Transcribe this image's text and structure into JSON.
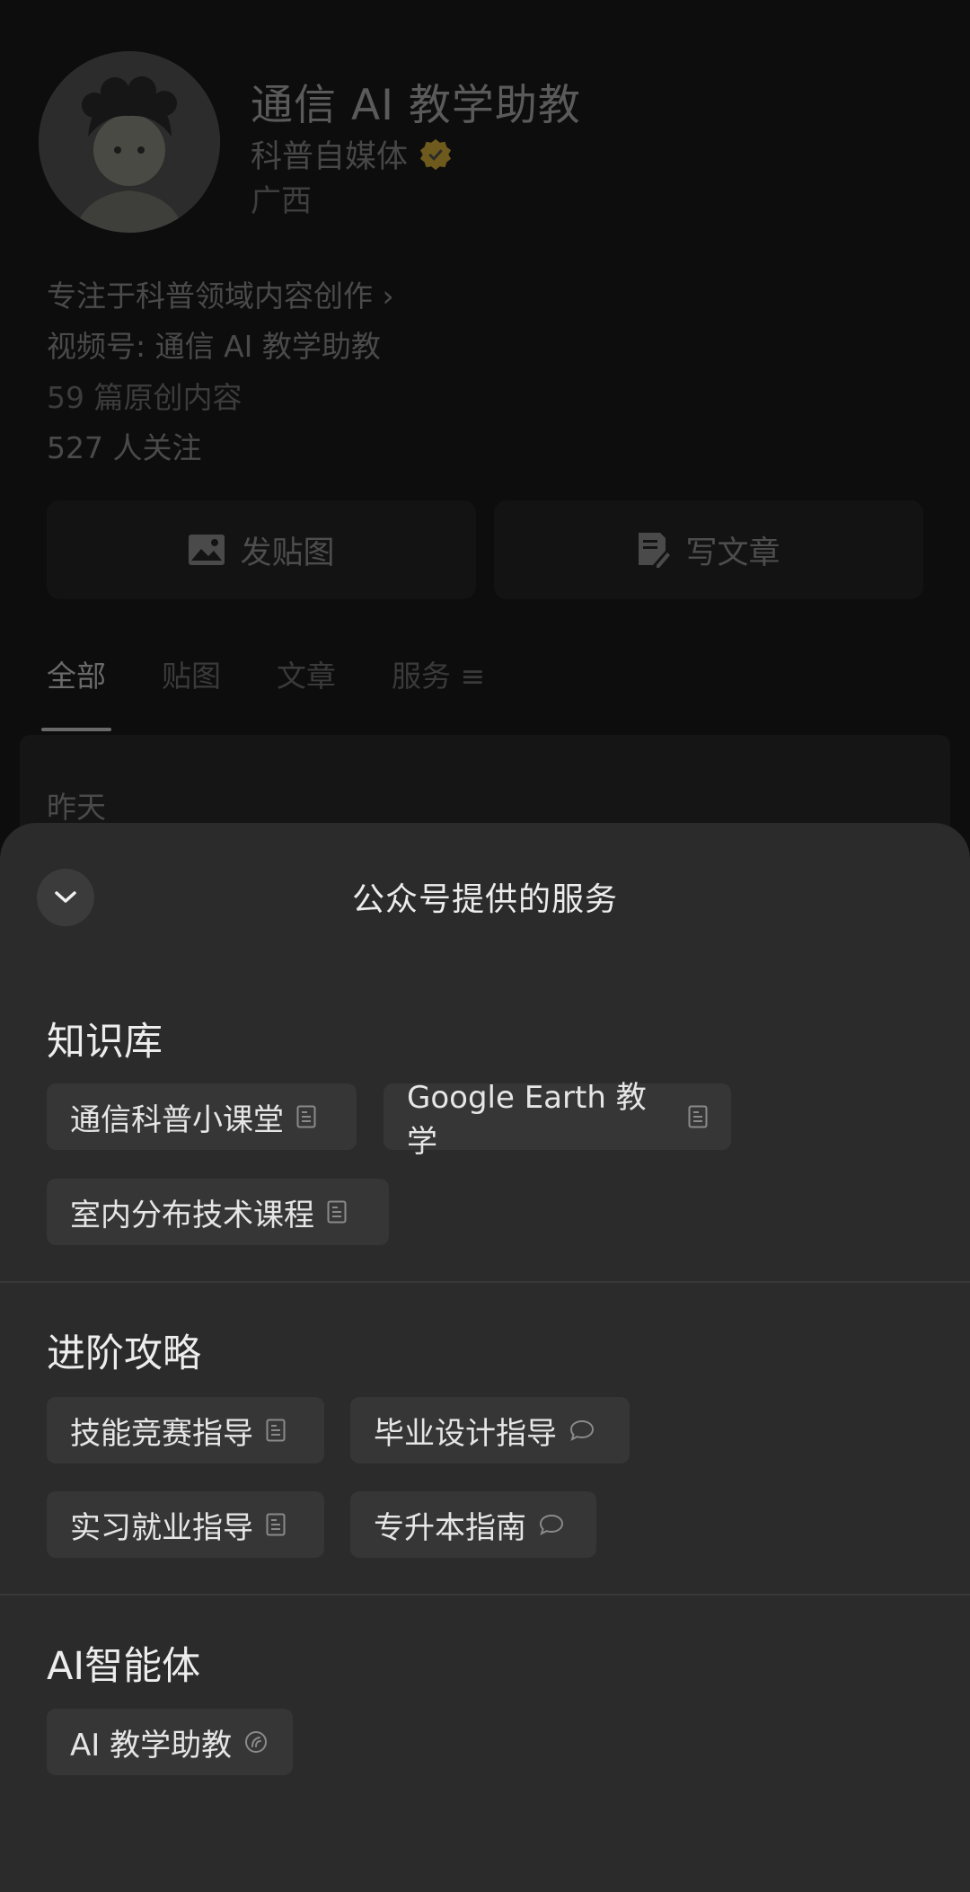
{
  "profile": {
    "name": "通信 AI 教学助教",
    "type": "科普自媒体",
    "region": "广西",
    "description": "专注于科普领域内容创作 ›",
    "channel": "视频号: 通信 AI 教学助教",
    "original_count": "59 篇原创内容",
    "followers": "527 人关注",
    "post_image_label": "发贴图",
    "write_article_label": "写文章",
    "tabs": [
      "全部",
      "贴图",
      "文章",
      "服务 ≡"
    ],
    "feed_date": "昨天"
  },
  "sheet": {
    "title": "公众号提供的服务",
    "sections": [
      {
        "title": "知识库",
        "items": [
          {
            "label": "通信科普小课堂",
            "icon": "document-icon"
          },
          {
            "label": "Google Earth 教学",
            "icon": "document-icon"
          },
          {
            "label": "室内分布技术课程",
            "icon": "document-icon"
          }
        ]
      },
      {
        "title": "进阶攻略",
        "items": [
          {
            "label": "技能竞赛指导",
            "icon": "document-icon"
          },
          {
            "label": "毕业设计指导",
            "icon": "chat-bubble-icon"
          },
          {
            "label": "实习就业指导",
            "icon": "document-icon"
          },
          {
            "label": "专升本指南",
            "icon": "chat-bubble-icon"
          }
        ]
      },
      {
        "title": "AI智能体",
        "items": [
          {
            "label": "AI 教学助教",
            "icon": "ai-agent-icon"
          }
        ]
      }
    ]
  },
  "colors": {
    "sheet_bg": "#2b2b2b",
    "chip_bg": "#363636",
    "verified_badge": "#8a6d1a"
  }
}
